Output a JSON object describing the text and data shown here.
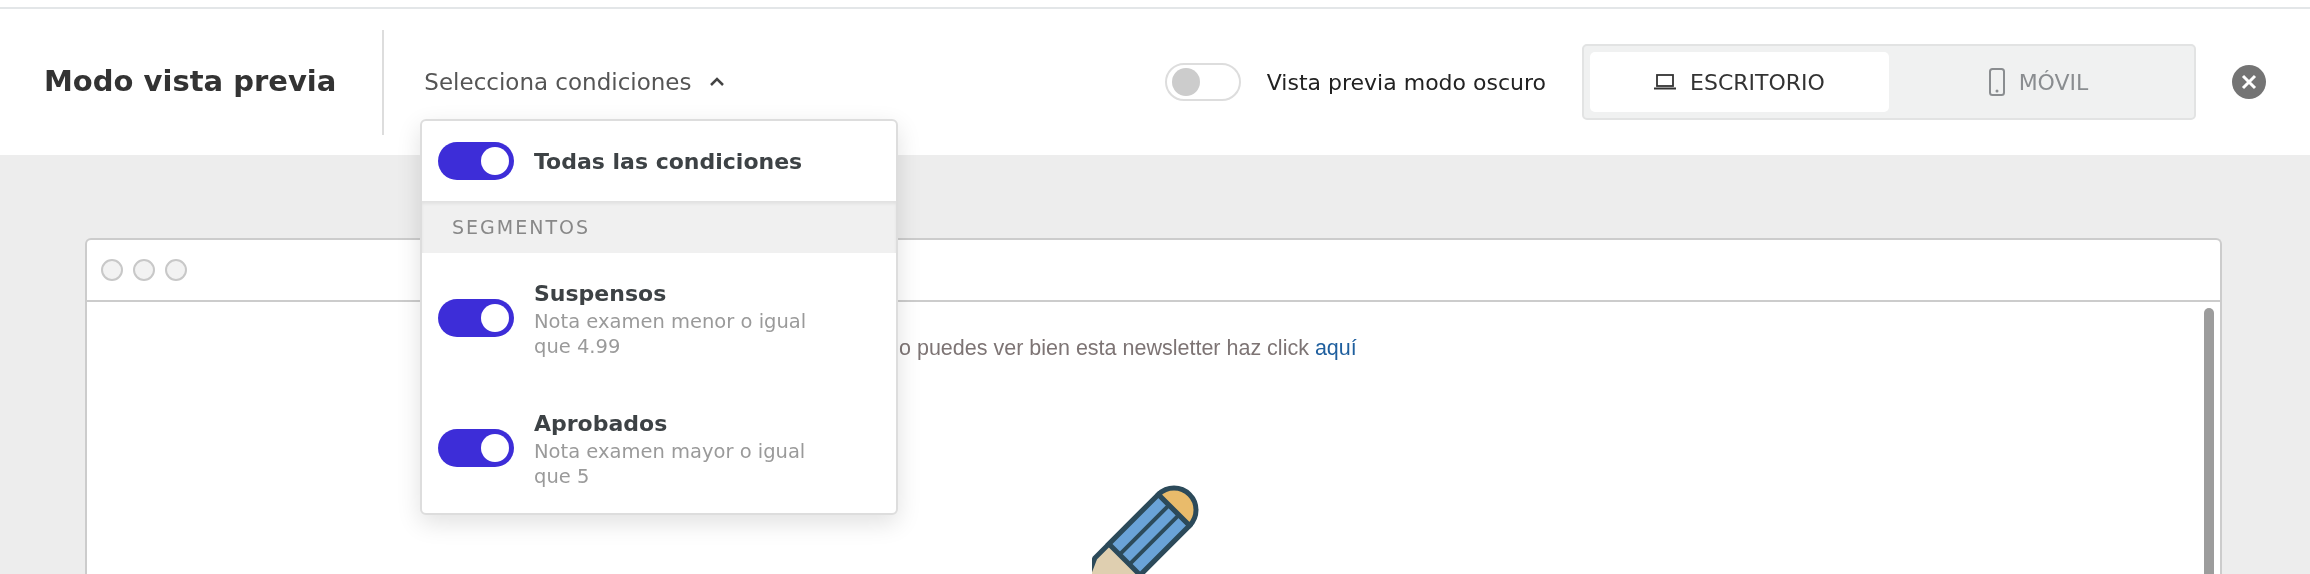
{
  "header": {
    "title": "Modo vista previa",
    "conditions_menu": {
      "label": "Selecciona condiciones",
      "expanded": true
    },
    "dark_preview": {
      "label": "Vista previa modo oscuro",
      "on": false
    },
    "devices": [
      {
        "label": "ESCRITORIO",
        "kind": "desktop",
        "selected": true
      },
      {
        "label": "MÓVIL",
        "kind": "mobile",
        "selected": false
      }
    ]
  },
  "conditions_dropdown": {
    "all": {
      "label": "Todas las condiciones",
      "on": true
    },
    "section": "SEGMENTOS",
    "segments": [
      {
        "name": "Suspensos",
        "description": "Nota examen menor o igual que 4.99",
        "on": true
      },
      {
        "name": "Aprobados",
        "description": "Nota examen mayor o igual que 5",
        "on": true
      }
    ]
  },
  "preview": {
    "notice": "o puedes ver bien esta newsletter haz click",
    "link": "aquí"
  }
}
